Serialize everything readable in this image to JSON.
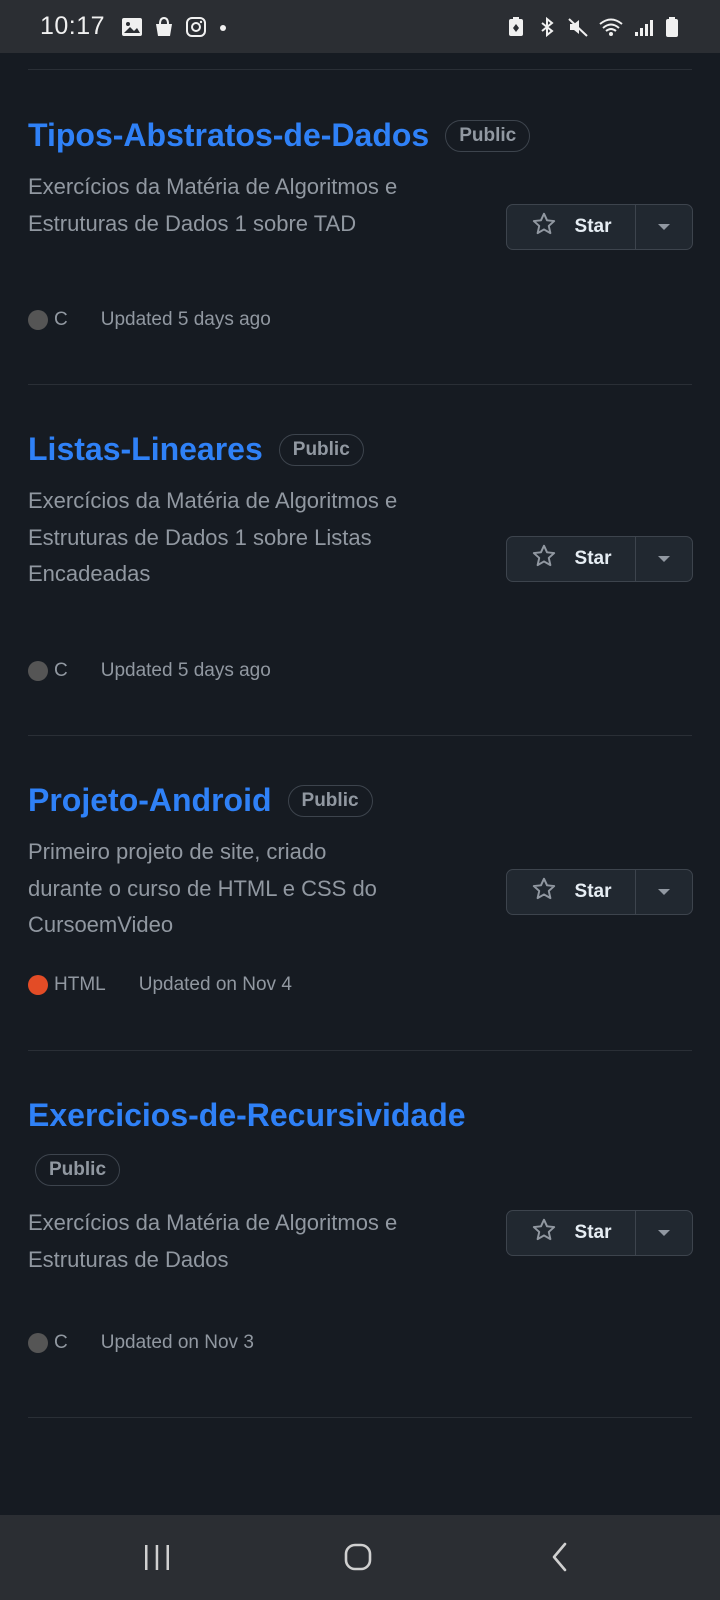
{
  "status_bar": {
    "time": "10:17",
    "left_icons": [
      "gallery-icon",
      "shopping-bag-icon",
      "instagram-icon",
      "dot-icon"
    ],
    "right_icons": [
      "battery-saver-icon",
      "bluetooth-icon",
      "mute-icon",
      "wifi-icon",
      "signal-icon",
      "battery-icon"
    ]
  },
  "repos": [
    {
      "name": "Tipos-Abstratos-de-Dados",
      "visibility": "Public",
      "description": "Exercícios da Matéria de Algoritmos e Estruturas de Dados 1 sobre TAD",
      "language": "C",
      "language_color": "#555555",
      "updated": "Updated 5 days ago",
      "star_label": "Star"
    },
    {
      "name": "Listas-Lineares",
      "visibility": "Public",
      "description": "Exercícios da Matéria de Algoritmos e Estruturas de Dados 1 sobre Listas Encadeadas",
      "language": "C",
      "language_color": "#555555",
      "updated": "Updated 5 days ago",
      "star_label": "Star"
    },
    {
      "name": "Projeto-Android",
      "visibility": "Public",
      "description": "Primeiro projeto de site, criado durante o curso de HTML e CSS do CursoemVideo",
      "language": "HTML",
      "language_color": "#e34c26",
      "updated": "Updated on Nov 4",
      "star_label": "Star"
    },
    {
      "name": "Exercicios-de-Recursividade",
      "visibility": "Public",
      "description": "Exercícios da Matéria de Algoritmos e Estruturas de Dados",
      "language": "C",
      "language_color": "#555555",
      "updated": "Updated on Nov 3",
      "star_label": "Star"
    }
  ],
  "nav_bar": {
    "items": [
      "recent-apps-icon",
      "home-icon",
      "back-icon"
    ]
  }
}
